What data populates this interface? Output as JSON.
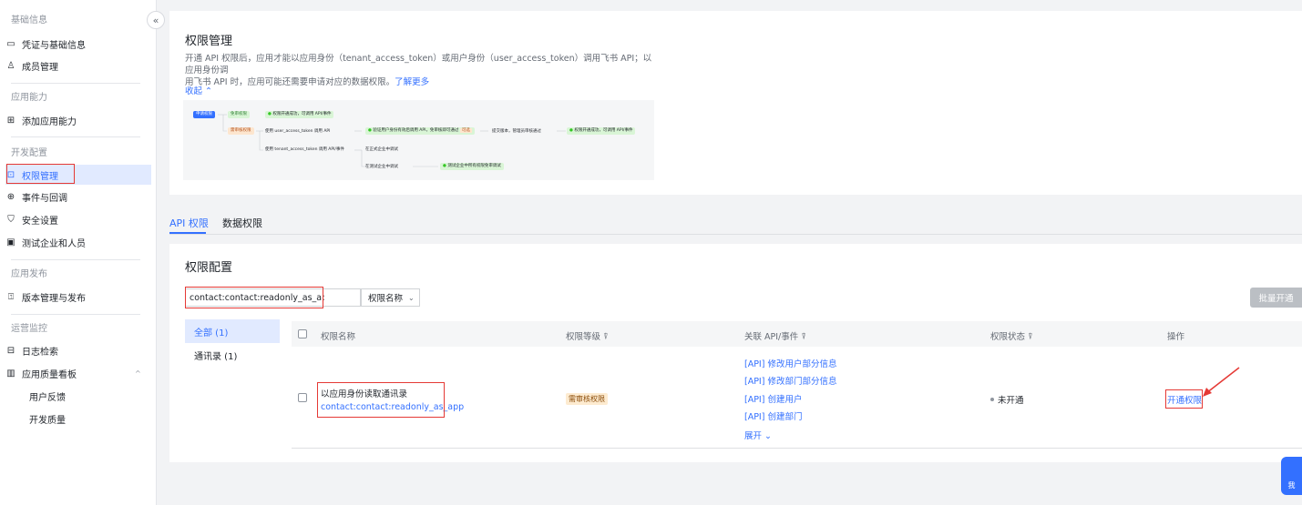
{
  "sidebar": {
    "collapse_glyph": "«",
    "sections": [
      {
        "title": "基础信息"
      },
      {
        "title": "应用能力"
      },
      {
        "title": "开发配置"
      },
      {
        "title": "应用发布"
      },
      {
        "title": "运营监控"
      }
    ],
    "items": [
      {
        "label": "凭证与基础信息",
        "icon": "id-card-icon"
      },
      {
        "label": "成员管理",
        "icon": "user-icon"
      },
      {
        "label": "添加应用能力",
        "icon": "grid-icon"
      },
      {
        "label": "权限管理",
        "icon": "lock-box-icon",
        "active": true
      },
      {
        "label": "事件与回调",
        "icon": "event-icon"
      },
      {
        "label": "安全设置",
        "icon": "shield-icon"
      },
      {
        "label": "测试企业和人员",
        "icon": "test-icon"
      },
      {
        "label": "版本管理与发布",
        "icon": "upload-icon"
      },
      {
        "label": "日志检索",
        "icon": "log-icon"
      },
      {
        "label": "应用质量看板",
        "icon": "chart-icon",
        "expand_glyph": "^"
      },
      {
        "label": "用户反馈"
      },
      {
        "label": "开发质量"
      }
    ]
  },
  "intro": {
    "title": "权限管理",
    "desc_line1": "开通 API 权限后，应用才能以应用身份（tenant_access_token）或用户身份（user_access_token）调用飞书 API；以应用身份调",
    "desc_line2": "用飞书 API 时，应用可能还需要申请对应的数据权限。",
    "learn_more": "了解更多",
    "collapse": "收起",
    "flow": {
      "start": "申请权限",
      "no_review": "免审权限",
      "no_review_result": "权限开通成功，可调用 API/事件",
      "need_review": "需审核权限",
      "user_token": "使用 user_access_token 调用 API",
      "user_result": "验证用户身份有效后调用 API，免审核即可通过",
      "tag": "可选",
      "submit": "提交版本，管理员审核通过",
      "final": "权限开通成功，可调用 API/事件",
      "tenant_token": "使用 tenant_access_token 调用 API/事件",
      "formal": "在正式企业中调试",
      "test": "在测试企业中调试",
      "test_result": "测试企业中所有权限免审调试"
    }
  },
  "tabs": [
    {
      "label": "API 权限",
      "active": true
    },
    {
      "label": "数据权限"
    }
  ],
  "config": {
    "title": "权限配置",
    "search_value": "contact:contact:readonly_as_app",
    "search_field": "权限名称",
    "batch_button": "批量开通",
    "categories": [
      {
        "label": "全部 (1)",
        "active": true
      },
      {
        "label": "通讯录 (1)"
      }
    ],
    "columns": [
      "权限名称",
      "权限等级",
      "关联 API/事件",
      "权限状态",
      "操作"
    ],
    "row": {
      "name": "以应用身份读取通讯录",
      "code": "contact:contact:readonly_as_app",
      "level": "需审核权限",
      "apis": [
        "[API] 修改用户部分信息",
        "[API] 修改部门部分信息",
        "[API] 创建用户",
        "[API] 创建部门"
      ],
      "expand": "展开",
      "status": "未开通",
      "action": "开通权限"
    }
  },
  "float_button": "我"
}
